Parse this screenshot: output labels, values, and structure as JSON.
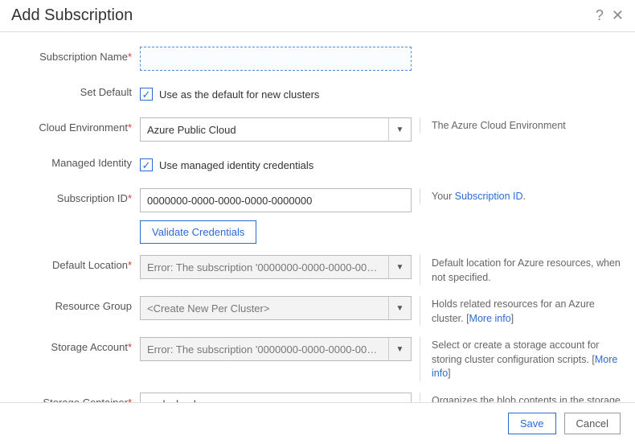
{
  "header": {
    "title": "Add Subscription"
  },
  "fields": {
    "subscription_name": {
      "label": "Subscription Name",
      "value": ""
    },
    "set_default": {
      "label": "Set Default",
      "checkbox_label": "Use as the default for new clusters",
      "checked": true
    },
    "cloud_env": {
      "label": "Cloud Environment",
      "value": "Azure Public Cloud",
      "help": "The Azure Cloud Environment"
    },
    "managed_identity": {
      "label": "Managed Identity",
      "checkbox_label": "Use managed identity credentials",
      "checked": true
    },
    "subscription_id": {
      "label": "Subscription ID",
      "value": "0000000-0000-0000-0000-0000000",
      "help_prefix": "Your ",
      "help_link": "Subscription ID",
      "help_suffix": "."
    },
    "validate_btn": "Validate Credentials",
    "default_location": {
      "label": "Default Location",
      "value": "Error: The subscription '0000000-0000-0000-0000-0",
      "help": "Default location for Azure resources, when not specified."
    },
    "resource_group": {
      "label": "Resource Group",
      "value": "<Create New Per Cluster>",
      "help_text": "Holds related resources for an Azure cluster. [",
      "help_link": "More info",
      "help_close": "]"
    },
    "storage_account": {
      "label": "Storage Account",
      "value": "Error: The subscription '0000000-0000-0000-0000-0",
      "help_text": "Select or create a storage account for storing cluster configuration scripts. [",
      "help_link": "More info",
      "help_close": "]"
    },
    "storage_container": {
      "label": "Storage Container",
      "value": "cyclecloud",
      "help": "Organizes the blob contents in the storage account. Created if it does not already exist."
    }
  },
  "footer": {
    "save": "Save",
    "cancel": "Cancel"
  }
}
